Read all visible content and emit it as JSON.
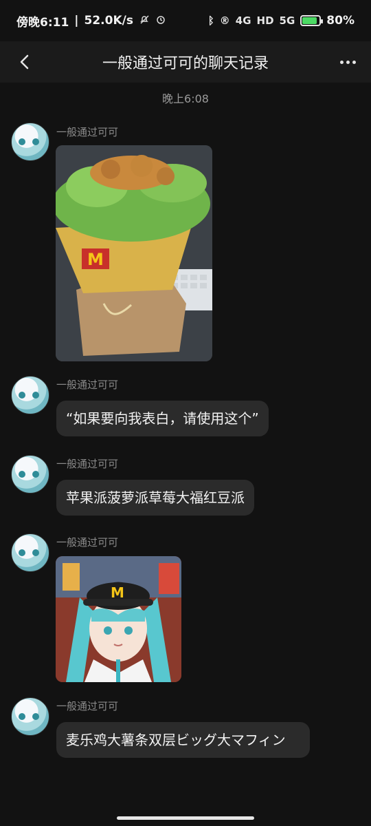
{
  "status": {
    "time": "傍晚6:11",
    "speed": "52.0K/s",
    "network1": "4G",
    "network2": "5G",
    "hd": "HD",
    "battery": "80%"
  },
  "header": {
    "title": "一般通过可可的聊天记录"
  },
  "timeline": {
    "time": "晚上6:08"
  },
  "messages": [
    {
      "name": "一般通过可可"
    },
    {
      "name": "一般通过可可",
      "text": "“如果要向我表白，请使用这个”"
    },
    {
      "name": "一般通过可可",
      "text": "苹果派菠萝派草莓大福红豆派"
    },
    {
      "name": "一般通过可可"
    },
    {
      "name": "一般通过可可",
      "text": "麦乐鸡大薯条双层ビッグ大マフィン"
    }
  ],
  "colors": {
    "background": "#121212",
    "bubble": "#2b2b2b",
    "battery_fill": "#4cd964"
  }
}
